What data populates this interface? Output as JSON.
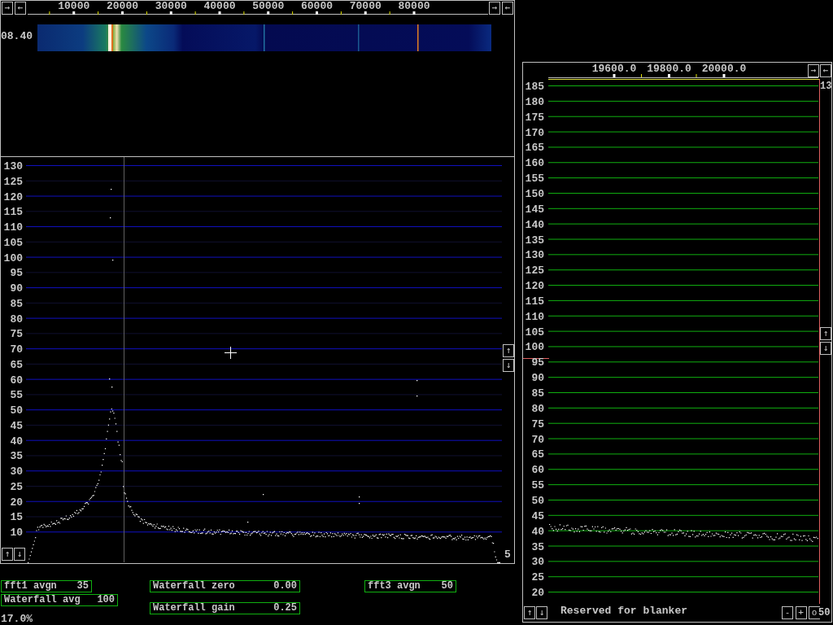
{
  "waterfall_window": {
    "nav_buttons_left": [
      "→",
      "←"
    ],
    "frequency_labels": [
      "10000",
      "20000",
      "30000",
      "40000",
      "50000",
      "60000",
      "70000",
      "80000"
    ],
    "nav_buttons_right": [
      "→",
      "←"
    ],
    "time_label": "08.40"
  },
  "spectrum_window": {
    "y_labels": [
      "130",
      "125",
      "120",
      "115",
      "110",
      "105",
      "100",
      "95",
      "90",
      "85",
      "80",
      "75",
      "70",
      "65",
      "60",
      "55",
      "50",
      "45",
      "40",
      "35",
      "30",
      "25",
      "20",
      "15",
      "10"
    ],
    "scroll_buttons_right": [
      "↑",
      "↓"
    ],
    "scroll_buttons_left": [
      "↑",
      "↓"
    ],
    "corner_label": "5"
  },
  "parameters": [
    {
      "label": "fft1 avgn",
      "value": "35"
    },
    {
      "label": "Waterfall avg",
      "value": "100"
    },
    {
      "label": "Waterfall zero",
      "value": "0.00"
    },
    {
      "label": "Waterfall gain",
      "value": "0.25"
    },
    {
      "label": "fft3 avgn",
      "value": "50"
    }
  ],
  "status": "17.0%",
  "baseband_window": {
    "frequency_labels": [
      "19600.0",
      "19800.0",
      "20000.0"
    ],
    "nav_buttons": [
      "→",
      "←"
    ],
    "corner_label": "13",
    "y_labels": [
      "185",
      "180",
      "175",
      "170",
      "165",
      "160",
      "155",
      "150",
      "145",
      "140",
      "135",
      "130",
      "125",
      "120",
      "115",
      "110",
      "105",
      "100",
      "95",
      "90",
      "85",
      "80",
      "75",
      "70",
      "65",
      "60",
      "55",
      "50",
      "45",
      "40",
      "35",
      "30",
      "25",
      "20"
    ],
    "scroll_buttons_right": [
      "↑",
      "↓"
    ],
    "scroll_buttons_left": [
      "↑",
      "↓"
    ],
    "blanker_label": "Reserved for blanker",
    "gain_buttons": [
      "-",
      "+",
      "o"
    ],
    "gain_value": "50"
  }
}
